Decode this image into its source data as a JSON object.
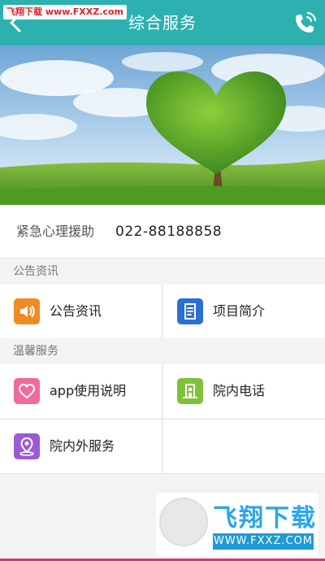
{
  "header": {
    "title": "综合服务",
    "watermark": "飞翔下载 www.FXXZ.com"
  },
  "hotline": {
    "label": "紧急心理援助",
    "number": "022-88188858"
  },
  "sections": [
    {
      "title": "公告资讯",
      "items": [
        {
          "label": "公告资讯",
          "icon": "speaker-icon",
          "color": "#f08a24"
        },
        {
          "label": "项目简介",
          "icon": "document-icon",
          "color": "#2b6fd0"
        }
      ]
    },
    {
      "title": "温馨服务",
      "items": [
        {
          "label": "app使用说明",
          "icon": "heart-icon",
          "color": "#f06b9a"
        },
        {
          "label": "院内电话",
          "icon": "building-icon",
          "color": "#7ec23a"
        },
        {
          "label": "院内外服务",
          "icon": "location-pin-icon",
          "color": "#9b5bd2"
        }
      ]
    }
  ],
  "watermark_bottom": {
    "brand": "飞翔下载",
    "url": "WWW.FXXZ.COM"
  },
  "colors": {
    "header": "#2cb1b0",
    "accent_strip": "#e02e84"
  }
}
